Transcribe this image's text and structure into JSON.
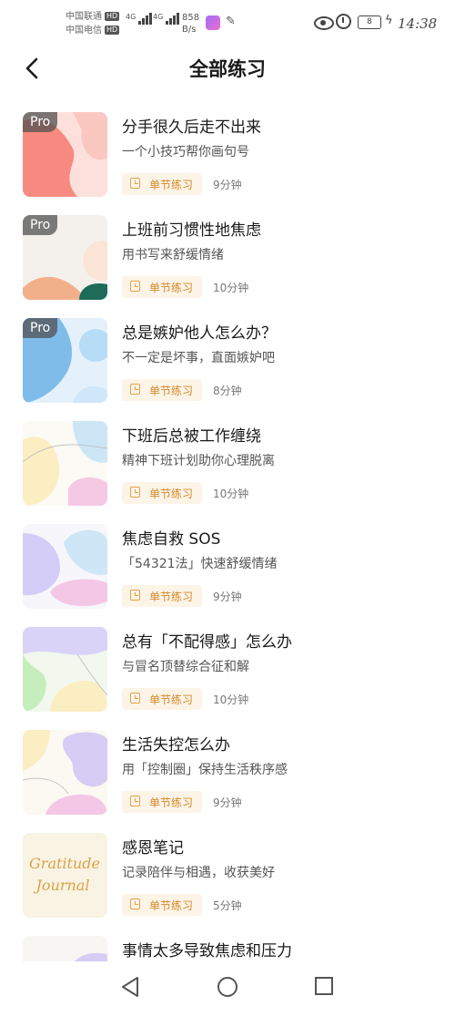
{
  "status_bar": {
    "carrier1": "中国联通",
    "carrier2": "中国电信",
    "hd": "HD",
    "net1": "4G",
    "net2": "4G",
    "speed_value": "858",
    "speed_unit": "B/s",
    "battery": "8",
    "time": "14:38"
  },
  "header": {
    "title": "全部练习"
  },
  "items": [
    {
      "title": "分手很久后走不出来",
      "desc": "一个小技巧帮你画句号",
      "tag": "单节练习",
      "duration": "9分钟",
      "pro": "Pro"
    },
    {
      "title": "上班前习惯性地焦虑",
      "desc": "用书写来舒缓情绪",
      "tag": "单节练习",
      "duration": "10分钟",
      "pro": "Pro"
    },
    {
      "title": "总是嫉妒他人怎么办？",
      "desc": "不一定是坏事，直面嫉妒吧",
      "tag": "单节练习",
      "duration": "8分钟",
      "pro": "Pro"
    },
    {
      "title": "下班后总被工作缠绕",
      "desc": "精神下班计划助你心理脱离",
      "tag": "单节练习",
      "duration": "10分钟"
    },
    {
      "title": "焦虑自救 SOS",
      "desc": "「54321法」快速舒缓情绪",
      "tag": "单节练习",
      "duration": "9分钟"
    },
    {
      "title": "总有「不配得感」怎么办",
      "desc": "与冒名顶替综合征和解",
      "tag": "单节练习",
      "duration": "10分钟"
    },
    {
      "title": "生活失控怎么办",
      "desc": "用「控制圈」保持生活秩序感",
      "tag": "单节练习",
      "duration": "9分钟"
    },
    {
      "title": "感恩笔记",
      "desc": "记录陪伴与相遇，收获美好",
      "tag": "单节练习",
      "duration": "5分钟",
      "thumb_text1": "Gratitude",
      "thumb_text2": "Journal"
    },
    {
      "title": "事情太多导致焦虑和压力"
    }
  ]
}
